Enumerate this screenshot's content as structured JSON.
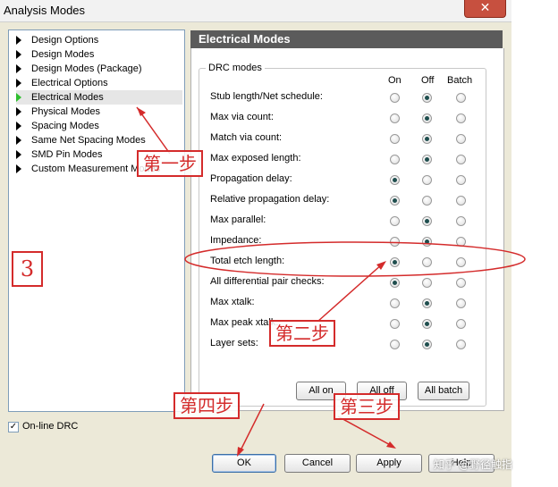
{
  "window": {
    "title": "Analysis Modes",
    "close_glyph": "✕"
  },
  "tree": {
    "items": [
      {
        "label": "Design Options"
      },
      {
        "label": "Design Modes"
      },
      {
        "label": "Design Modes (Package)"
      },
      {
        "label": "Electrical Options"
      },
      {
        "label": "Electrical Modes",
        "selected": true
      },
      {
        "label": "Physical Modes"
      },
      {
        "label": "Spacing Modes"
      },
      {
        "label": "Same Net Spacing Modes"
      },
      {
        "label": "SMD Pin Modes"
      },
      {
        "label": "Custom Measurement Modes"
      }
    ]
  },
  "panel": {
    "title": "Electrical Modes",
    "group_label": "DRC modes",
    "columns": [
      "On",
      "Off",
      "Batch"
    ],
    "rows": [
      {
        "label": "Stub length/Net schedule:",
        "value": "Off"
      },
      {
        "label": "Max via count:",
        "value": "Off"
      },
      {
        "label": "Match via count:",
        "value": "Off"
      },
      {
        "label": "Max exposed length:",
        "value": "Off"
      },
      {
        "label": "Propagation delay:",
        "value": "On"
      },
      {
        "label": "Relative propagation delay:",
        "value": "On"
      },
      {
        "label": "Max parallel:",
        "value": "Off"
      },
      {
        "label": "Impedance:",
        "value": "Off"
      },
      {
        "label": "Total etch length:",
        "value": "On"
      },
      {
        "label": "All differential pair checks:",
        "value": "On"
      },
      {
        "label": "Max xtalk:",
        "value": "Off"
      },
      {
        "label": "Max peak xtalk:",
        "value": "Off"
      },
      {
        "label": "Layer sets:",
        "value": "Off"
      }
    ],
    "buttons": {
      "all_on": "All on",
      "all_off": "All off",
      "all_batch": "All batch"
    }
  },
  "online_drc": {
    "label": "On-line DRC",
    "checked": true,
    "glyph": "✓"
  },
  "footer": {
    "ok": "OK",
    "cancel": "Cancel",
    "apply": "Apply",
    "help": "Help"
  },
  "annotations": {
    "step1": "第一步",
    "step2": "第二步",
    "step3": "第三步",
    "step4": "第四步",
    "number": "3",
    "color": "#d42b2b"
  },
  "watermark": "知乎 @野径触指"
}
